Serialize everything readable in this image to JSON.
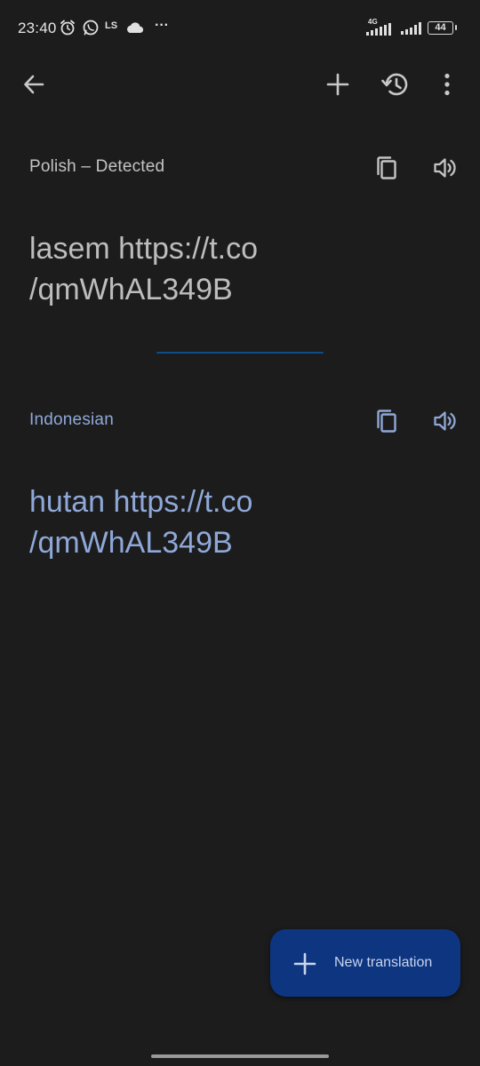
{
  "status_bar": {
    "time": "23:40",
    "carrier_text": "LS",
    "more": "···",
    "network_type": "4G",
    "battery": "44",
    "icons": [
      "alarm-icon",
      "whatsapp-icon",
      "cloud-icon",
      "signal-icon",
      "signal-icon",
      "battery-icon"
    ]
  },
  "app_bar": {
    "icons": [
      "back-arrow-icon",
      "plus-icon",
      "history-icon",
      "more-vert-icon"
    ]
  },
  "source": {
    "language": "Polish – Detected",
    "text": "lasem https://t.co\n/qmWhAL349B",
    "icons": [
      "copy-icon",
      "speaker-icon"
    ]
  },
  "target": {
    "language": "Indonesian",
    "text": "hutan https://t.co\n/qmWhAL349B",
    "icons": [
      "copy-icon",
      "speaker-icon"
    ]
  },
  "fab": {
    "label": "New translation",
    "icon": "plus-icon"
  },
  "colors": {
    "background": "#1c1c1c",
    "source_text": "#bdbdbd",
    "target_text": "#8fa8d8",
    "fab_background": "#0d3580",
    "divider": "#0d4d8a"
  }
}
